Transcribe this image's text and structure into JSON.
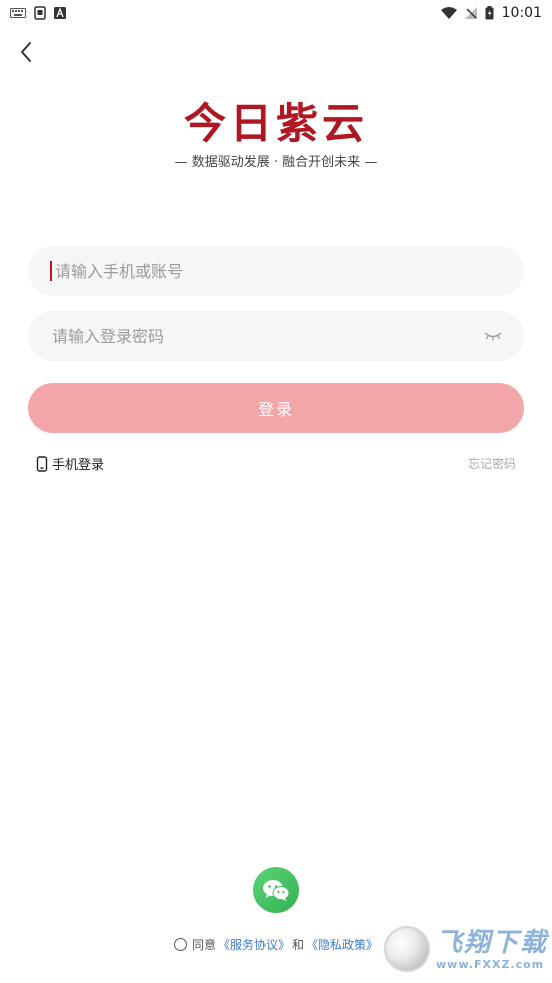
{
  "status_bar": {
    "left_icons": [
      "keyboard-icon",
      "sim-toolkit-icon",
      "text-a-icon"
    ],
    "right_icons": [
      "wifi-icon",
      "no-signal-icon",
      "battery-icon"
    ],
    "time": "10:01"
  },
  "header": {
    "back_icon": "chevron-left-icon"
  },
  "brand": {
    "logo_text": "今日紫云",
    "slogan": "— 数据驱动发展 · 融合开创未来 —",
    "logo_color": "#b11722"
  },
  "form": {
    "account_placeholder": "请输入手机或账号",
    "account_value": "",
    "password_placeholder": "请输入登录密码",
    "password_value": "",
    "password_toggle_icon": "eye-closed-icon",
    "login_label": "登录",
    "login_color": "#f2a6a8"
  },
  "links": {
    "phone_login": "手机登录",
    "phone_icon": "phone-icon",
    "forgot_password": "忘记密码"
  },
  "social": {
    "wechat_icon": "wechat-icon",
    "wechat_color": "#3cc05d"
  },
  "agreement": {
    "prefix": "同意",
    "service_link": "《服务协议》",
    "and": "和",
    "privacy_link": "《隐私政策》",
    "link_color": "#3b7bd4"
  },
  "watermark": {
    "name": "飞翔下载",
    "url": "www.FXXZ.com"
  }
}
